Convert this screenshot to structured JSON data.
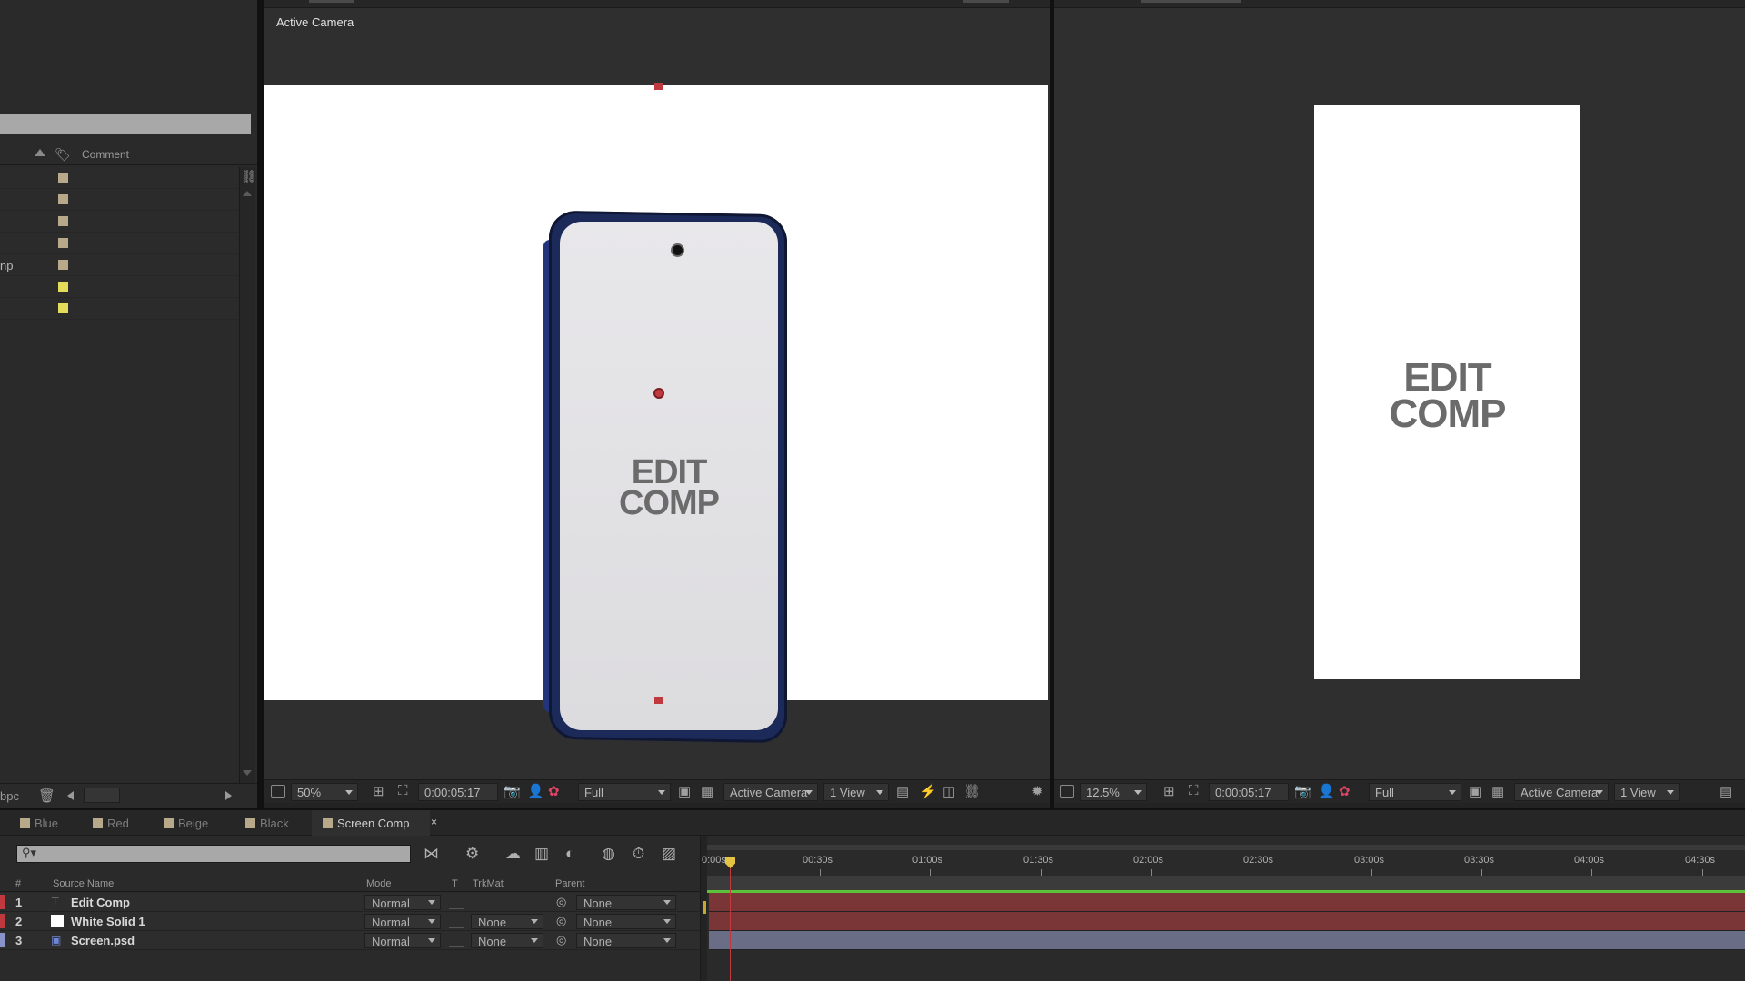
{
  "project": {
    "column_comment": "Comment",
    "rows": [
      {
        "name": "",
        "swatch": "#b7a98a"
      },
      {
        "name": "",
        "swatch": "#b7a98a"
      },
      {
        "name": "",
        "swatch": "#b7a98a"
      },
      {
        "name": "",
        "swatch": "#b7a98a"
      },
      {
        "name": "np",
        "swatch": "#b7a98a"
      },
      {
        "name": "",
        "swatch": "#e2dc5a"
      },
      {
        "name": "",
        "swatch": "#e2dc5a"
      }
    ],
    "footer_bpc": "bpc"
  },
  "viewerA": {
    "label": "Active Camera",
    "screen_text_line1": "EDIT",
    "screen_text_line2": "COMP",
    "zoom": "50%",
    "timecode": "0:00:05:17",
    "resolution": "Full",
    "camera": "Active Camera",
    "views": "1 View"
  },
  "viewerB": {
    "screen_text_line1": "EDIT",
    "screen_text_line2": "COMP",
    "zoom": "12.5%",
    "timecode": "0:00:05:17",
    "resolution": "Full",
    "camera": "Active Camera",
    "views": "1 View"
  },
  "timeline": {
    "tabs": [
      {
        "label": "Blue",
        "swatch": "#b7a98a",
        "active": false
      },
      {
        "label": "Red",
        "swatch": "#b7a98a",
        "active": false
      },
      {
        "label": "Beige",
        "swatch": "#b7a98a",
        "active": false
      },
      {
        "label": "Black",
        "swatch": "#b7a98a",
        "active": false
      },
      {
        "label": "Screen Comp",
        "swatch": "#b7a98a",
        "active": true
      }
    ],
    "tab_close": "×",
    "search_icon": "⚲▾",
    "columns": {
      "hash": "#",
      "source_name": "Source Name",
      "mode": "Mode",
      "t": "T",
      "trkmat": "TrkMat",
      "parent": "Parent"
    },
    "layers": [
      {
        "num": "1",
        "name": "Edit Comp",
        "mode": "Normal",
        "trkmat": "",
        "parent": "None",
        "label_color": "#c0393f",
        "bar_color": "#7a3636"
      },
      {
        "num": "2",
        "name": "White Solid 1",
        "mode": "Normal",
        "trkmat": "None",
        "parent": "None",
        "label_color": "#c0393f",
        "bar_color": "#7a3636"
      },
      {
        "num": "3",
        "name": "Screen.psd",
        "mode": "Normal",
        "trkmat": "None",
        "parent": "None",
        "label_color": "#8a93c8",
        "bar_color": "#6a6d86"
      }
    ],
    "ruler_ticks": [
      "0:00s",
      "00:30s",
      "01:00s",
      "01:30s",
      "02:00s",
      "02:30s",
      "03:00s",
      "03:30s",
      "04:00s",
      "04:30s"
    ]
  },
  "colors": {
    "accent_red": "#c0393f",
    "work_area_green": "#5cc23a",
    "playhead_yellow": "#e6c443"
  }
}
